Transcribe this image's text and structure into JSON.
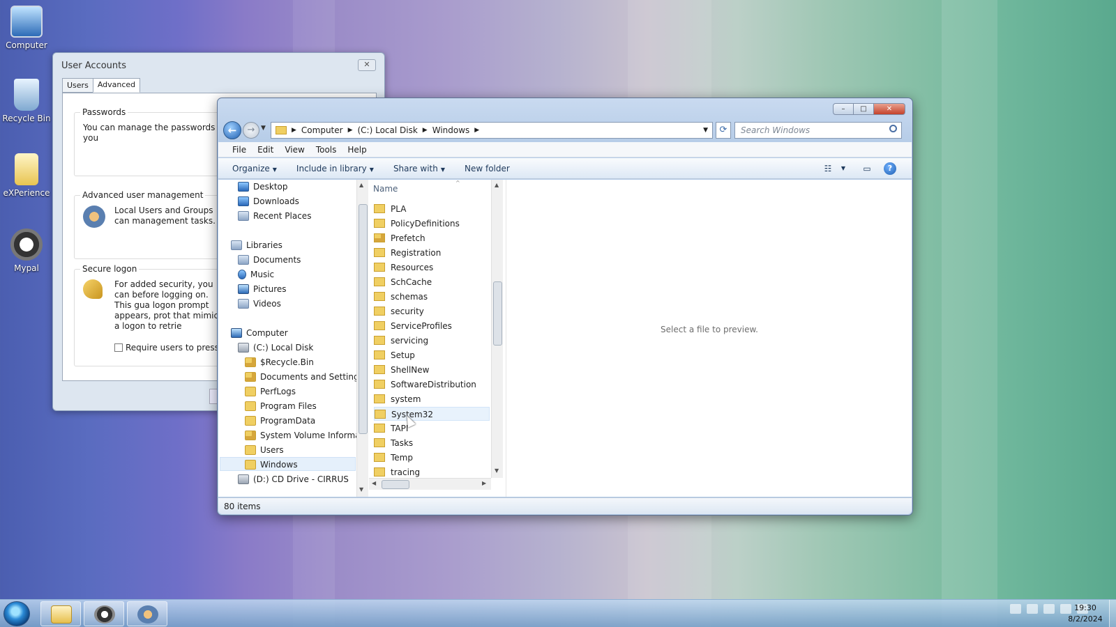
{
  "desktop": {
    "icons": [
      {
        "label": "Computer",
        "icon": "computer-icon"
      },
      {
        "label": "Recycle Bin",
        "icon": "recycle-bin-icon"
      },
      {
        "label": "eXPerience",
        "icon": "folder-icon"
      },
      {
        "label": "Mypal",
        "icon": "mypal-icon"
      }
    ]
  },
  "user_accounts": {
    "title": "User Accounts",
    "close": "✕",
    "tabs": [
      "Users",
      "Advanced"
    ],
    "active_tab": "Advanced",
    "passwords_title": "Passwords",
    "passwords_text": "You can manage the passwords you",
    "advanced_title": "Advanced user management",
    "advanced_text": "Local Users and Groups can management tasks.",
    "secure_title": "Secure logon",
    "secure_text": "For added security, you can before logging on. This gua logon prompt appears, prot that mimic a logon to retrie",
    "checkbox_label": "Require users to press Ct"
  },
  "explorer": {
    "window_buttons": {
      "minimize": "–",
      "maximize": "□",
      "close": "✕"
    },
    "address": {
      "crumbs": [
        "Computer",
        "(C:) Local Disk",
        "Windows"
      ]
    },
    "search_placeholder": "Search Windows",
    "menu": [
      "File",
      "Edit",
      "View",
      "Tools",
      "Help"
    ],
    "commands": [
      "Organize",
      "Include in library",
      "Share with",
      "New folder"
    ],
    "tree": [
      {
        "label": "Desktop",
        "icon": "desktop-icon"
      },
      {
        "label": "Downloads",
        "icon": "downloads-icon"
      },
      {
        "label": "Recent Places",
        "icon": "recent-places-icon"
      },
      {
        "label": "Libraries",
        "icon": "libraries-icon"
      },
      {
        "label": "Documents",
        "icon": "documents-icon"
      },
      {
        "label": "Music",
        "icon": "music-icon"
      },
      {
        "label": "Pictures",
        "icon": "pictures-icon"
      },
      {
        "label": "Videos",
        "icon": "videos-icon"
      },
      {
        "label": "Computer",
        "icon": "computer-icon"
      },
      {
        "label": "(C:) Local Disk",
        "icon": "drive-icon"
      },
      {
        "label": "$Recycle.Bin",
        "icon": "locked-folder-icon"
      },
      {
        "label": "Documents and Settings",
        "icon": "locked-folder-icon"
      },
      {
        "label": "PerfLogs",
        "icon": "folder-icon"
      },
      {
        "label": "Program Files",
        "icon": "folder-icon"
      },
      {
        "label": "ProgramData",
        "icon": "folder-icon"
      },
      {
        "label": "System Volume Informa",
        "icon": "locked-folder-icon"
      },
      {
        "label": "Users",
        "icon": "folder-icon"
      },
      {
        "label": "Windows",
        "icon": "folder-icon",
        "selected": true
      },
      {
        "label": "(D:) CD Drive - CIRRUS",
        "icon": "cd-drive-icon"
      }
    ],
    "column_header": "Name",
    "files": [
      "PLA",
      "PolicyDefinitions",
      "Prefetch",
      "Registration",
      "Resources",
      "SchCache",
      "schemas",
      "security",
      "ServiceProfiles",
      "servicing",
      "Setup",
      "ShellNew",
      "SoftwareDistribution",
      "system",
      "System32",
      "TAPI",
      "Tasks",
      "Temp",
      "tracing"
    ],
    "hovered_file": "System32",
    "preview_message": "Select a file to preview.",
    "status": "80 items"
  },
  "taskbar": {
    "clock_time": "19:30",
    "clock_date": "8/2/2024"
  }
}
